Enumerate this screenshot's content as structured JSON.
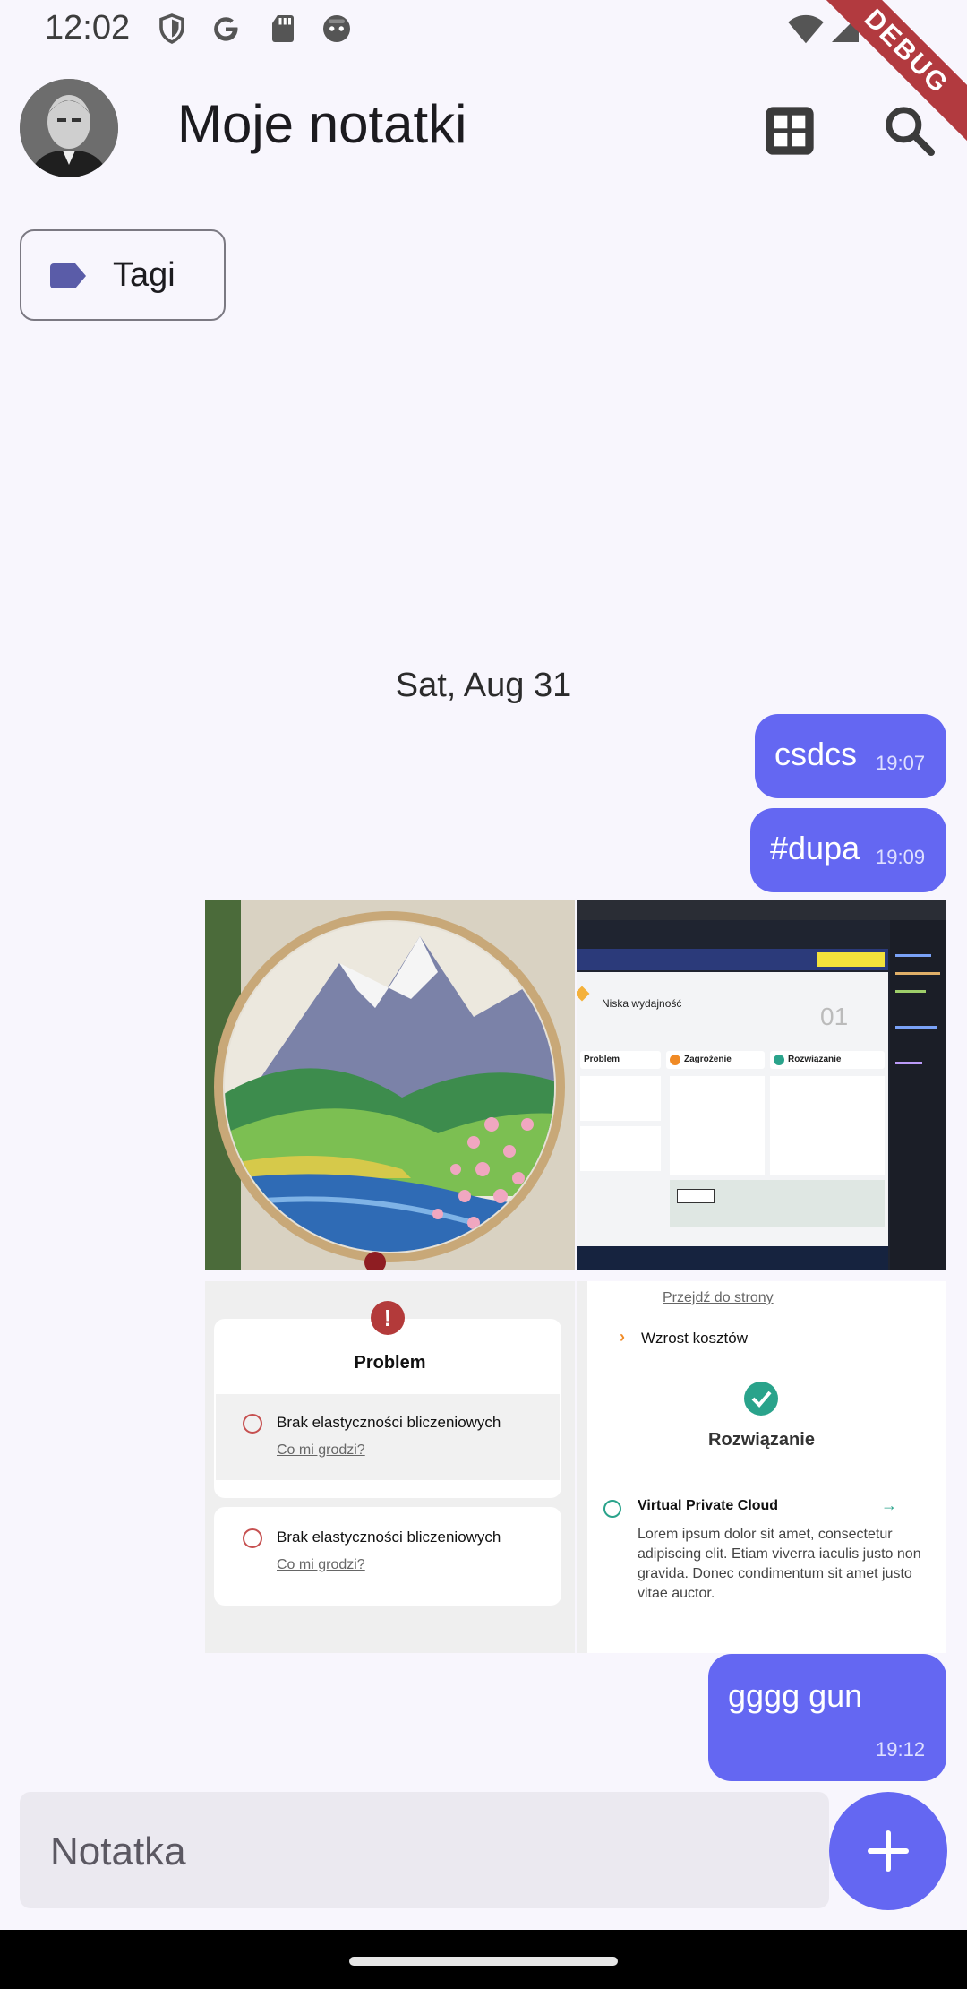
{
  "status_bar": {
    "time": "12:02",
    "icons_left": [
      "shield-icon",
      "google-icon",
      "sd-card-icon",
      "android-face-icon"
    ],
    "icons_right": [
      "wifi-icon",
      "cell-signal-icon",
      "battery-icon"
    ],
    "debug_label": "DEBUG"
  },
  "app_bar": {
    "title": "Moje notatki",
    "actions": [
      "grid-view-icon",
      "search-icon"
    ]
  },
  "tags_chip": {
    "label": "Tagi",
    "color": "#5a5ca8"
  },
  "messages": {
    "date": "Sat, Aug 31",
    "bubbles": [
      {
        "text": "csdcs",
        "time": "19:07"
      },
      {
        "text": "#dupa",
        "time": "19:09"
      },
      {
        "text": "gggg gun",
        "time": "19:12"
      }
    ],
    "images": [
      {
        "name": "embroidery-mountain-photo"
      },
      {
        "name": "website-screenshot-1"
      },
      {
        "name": "problem-card-screenshot"
      },
      {
        "name": "solution-card-screenshot"
      }
    ],
    "screenshot_texts": {
      "s2_heading": "Niska wydajność",
      "s2_number": "01",
      "s2_col1": "Problem",
      "s2_col2": "Zagrożenie",
      "s2_col3": "Rozwiązanie",
      "s3_title": "Problem",
      "s3_item1": "Brak elastyczności bliczeniowych",
      "s3_link1": "Co mi grodzi?",
      "s3_item2": "Brak elastyczności bliczeniowych",
      "s3_link2": "Co mi grodzi?",
      "s4_link": "Przejdź do strony",
      "s4_item": "Wzrost kosztów",
      "s4_title": "Rozwiązanie",
      "s4_sub": "Virtual Private Cloud",
      "s4_para": "Lorem ipsum dolor sit amet, consectetur adipiscing elit. Etiam viverra iaculis justo non gravida. Donec condimentum sit amet justo vitae auctor."
    }
  },
  "input": {
    "placeholder": "Notatka"
  },
  "colors": {
    "accent": "#6467f2",
    "background": "#f8f6fd"
  }
}
